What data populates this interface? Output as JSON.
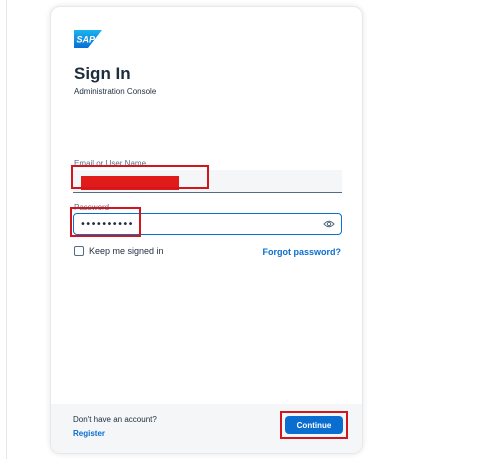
{
  "brand": {
    "logo_text": "SAP",
    "logo_color": "#0a6ed1"
  },
  "form": {
    "title": "Sign In",
    "subtitle": "Administration Console",
    "username_label": "Email or User Name",
    "username_value": "",
    "password_label": "Password",
    "password_value": "••••••••••",
    "remember_label": "Keep me signed in",
    "remember_checked": false,
    "forgot_label": "Forgot password?"
  },
  "footer": {
    "no_account_text": "Don't have an account?",
    "register_label": "Register",
    "continue_label": "Continue"
  },
  "colors": {
    "accent": "#0a6ed1",
    "annotation": "#d3151d",
    "redaction": "#e11a1a",
    "footer_bg": "#f4f6f8"
  },
  "icons": {
    "password_toggle": "eye-icon"
  }
}
